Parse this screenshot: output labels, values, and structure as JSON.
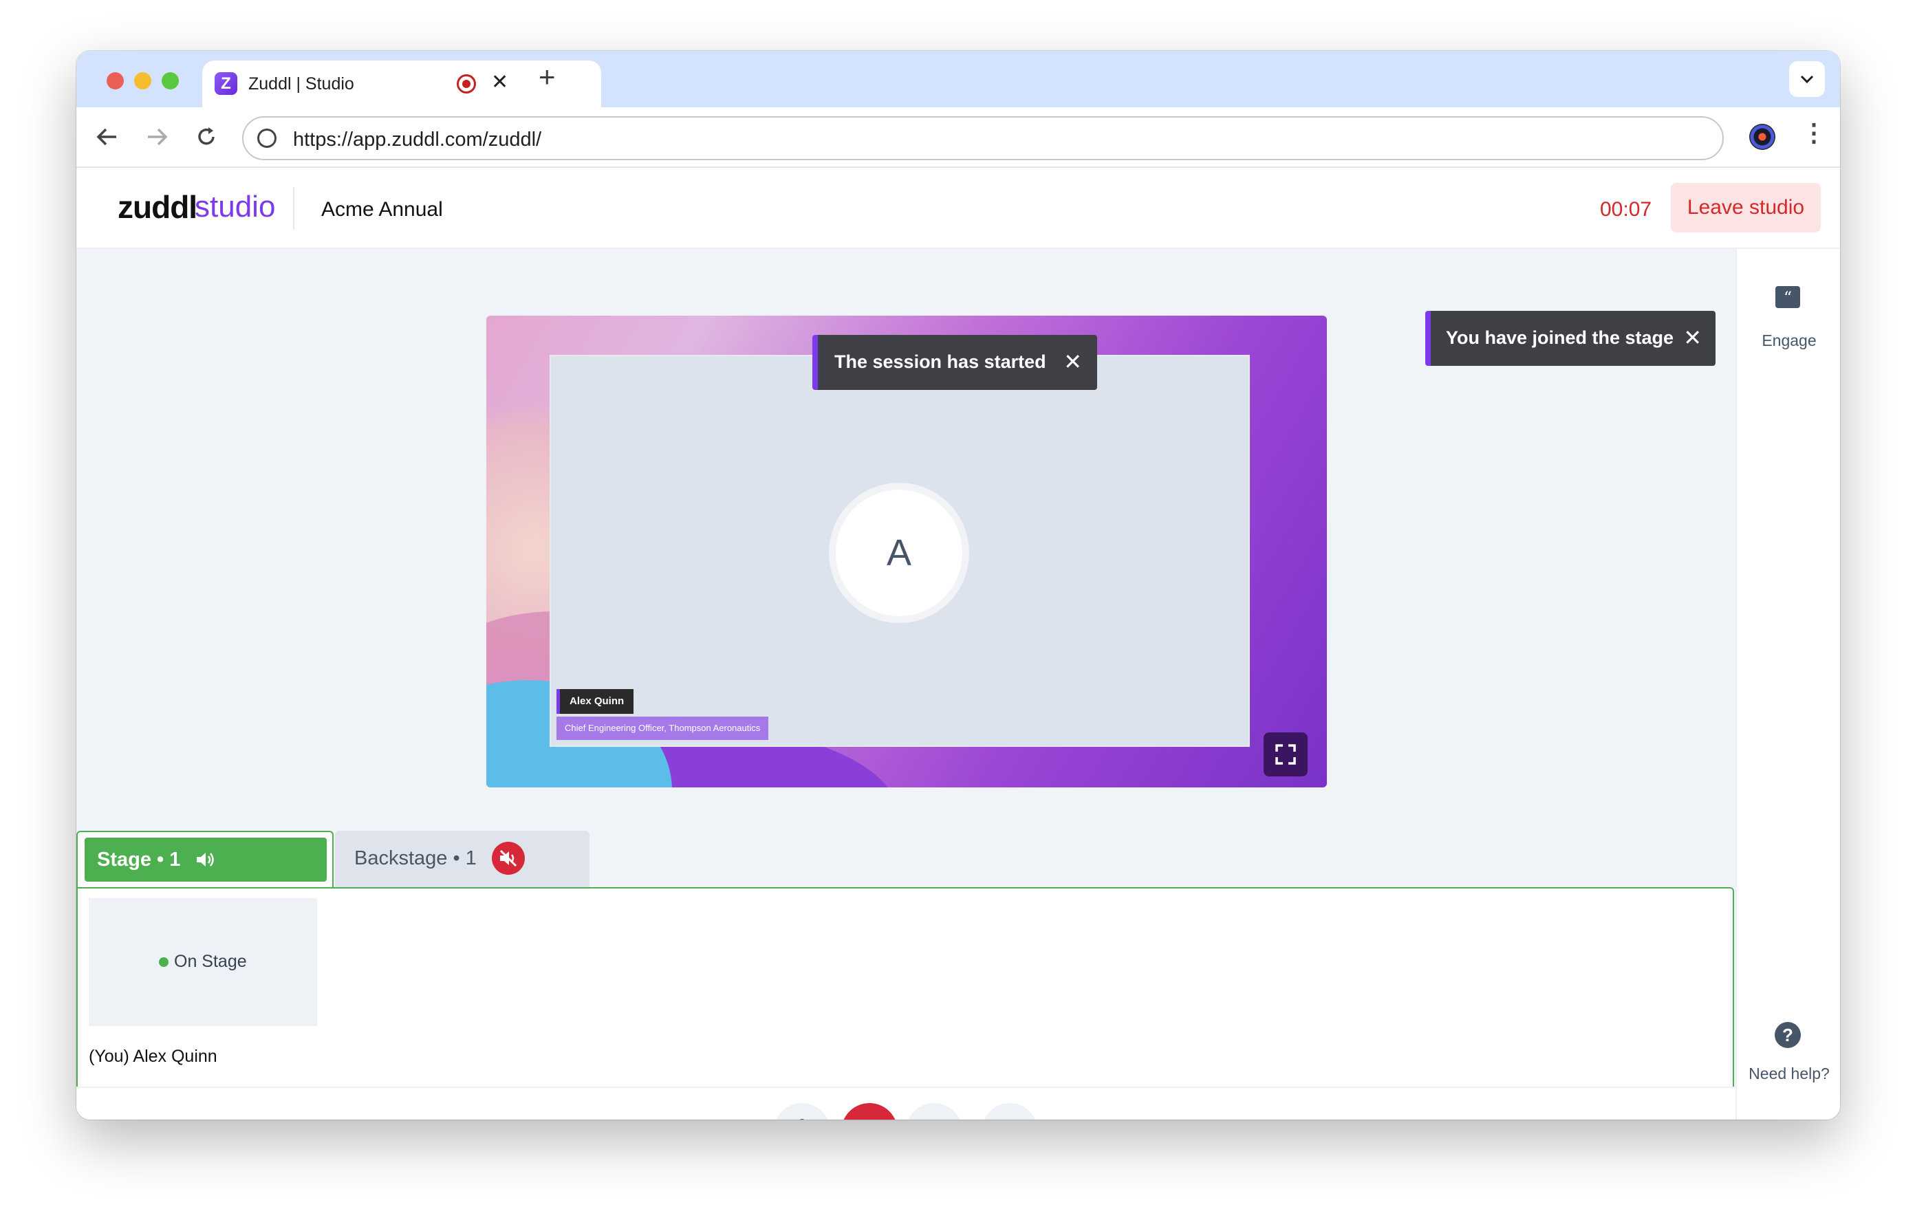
{
  "browser": {
    "tab_title": "Zuddl | Studio",
    "tab_favicon_letter": "Z",
    "tab_close": "✕",
    "new_tab": "+",
    "url": "https://app.zuddl.com/zuddl/"
  },
  "header": {
    "logo_bold": "zuddl",
    "logo_light": "studio",
    "event_name": "Acme Annual",
    "timer": "00:07",
    "leave_label": "Leave studio"
  },
  "stage_preview": {
    "avatar_initial": "A",
    "speaker_name": "Alex Quinn",
    "speaker_title": "Chief Engineering Officer, Thompson Aeronautics",
    "toast": "The session has started"
  },
  "notifications": {
    "joined_toast": "You have joined the stage"
  },
  "tabs": {
    "stage_label": "Stage • 1",
    "backstage_label": "Backstage • 1"
  },
  "participants": [
    {
      "status": "On Stage",
      "name": "(You) Alex Quinn"
    }
  ],
  "sidebar": {
    "engage_label": "Engage",
    "help_label": "Need help?"
  },
  "colors": {
    "accent": "#7c3aed",
    "stage_green": "#4caf50",
    "danger": "#d62828"
  },
  "icons": [
    "back-arrow-icon",
    "forward-arrow-icon",
    "reload-icon",
    "globe-icon",
    "kebab-menu-icon",
    "quote-icon",
    "help-icon",
    "speaker-icon",
    "muted-speaker-icon",
    "fullscreen-icon",
    "microphone-icon",
    "camera-off-icon",
    "screen-share-icon",
    "settings-icon"
  ]
}
